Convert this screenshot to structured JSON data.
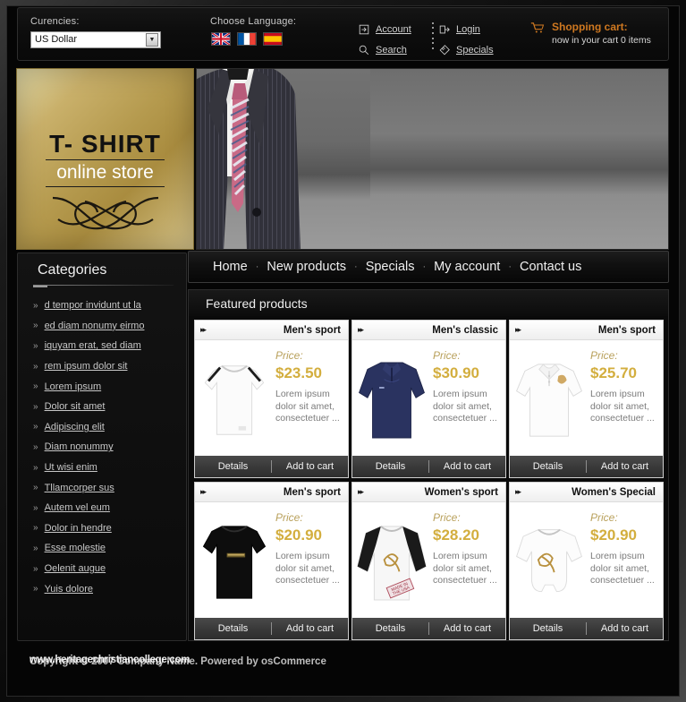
{
  "topbar": {
    "currency_label": "Curencies:",
    "currency_value": "US Dollar",
    "currency_options": [
      "US Dollar"
    ],
    "language_label": "Choose Language:",
    "flags": [
      {
        "name": "flag-english",
        "title": "English"
      },
      {
        "name": "flag-french",
        "title": "French"
      },
      {
        "name": "flag-spanish",
        "title": "Spanish"
      }
    ],
    "links": [
      {
        "label": "Account",
        "icon": "account-icon"
      },
      {
        "label": "Login",
        "icon": "login-icon"
      },
      {
        "label": "Search",
        "icon": "search-icon"
      },
      {
        "label": "Specials",
        "icon": "specials-icon"
      }
    ],
    "cart_title": "Shopping cart:",
    "cart_sub": "now in your cart 0 items",
    "cart_icon": "shopping-cart-icon"
  },
  "logo": {
    "title": "T- SHIRT",
    "subtitle": "online store"
  },
  "nav": {
    "items": [
      "Home",
      "New products",
      "Specials",
      "My account",
      "Contact us"
    ],
    "separator": "·"
  },
  "sidebar": {
    "title": "Categories",
    "bullet": "»",
    "items": [
      "d tempor invidunt ut la",
      "ed diam nonumy eirmo",
      "iquyam erat, sed diam",
      "rem ipsum dolor sit",
      "Lorem ipsum",
      "Dolor sit amet",
      "Adipiscing elit",
      "Diam nonummy",
      "Ut wisi enim",
      "Tllamcorper sus",
      "Autem vel eum",
      "Dolor in hendre",
      "Esse molestie",
      "Oelenit augue",
      "Yuis dolore"
    ]
  },
  "featured": {
    "heading": "Featured products",
    "price_label": "Price:",
    "details_label": "Details",
    "add_to_cart_label": "Add to cart",
    "card_arrow": "▸▸",
    "products": [
      {
        "title": "Men's sport",
        "price": "$23.50",
        "desc": "Lorem ipsum dolor sit amet, consectetuer ...",
        "image": "white-tshirt"
      },
      {
        "title": "Men's classic",
        "price": "$30.90",
        "desc": "Lorem ipsum dolor sit amet, consectetuer ...",
        "image": "navy-pullover"
      },
      {
        "title": "Men's sport",
        "price": "$25.70",
        "desc": "Lorem ipsum dolor sit amet, consectetuer ...",
        "image": "white-polo"
      },
      {
        "title": "Men's sport",
        "price": "$20.90",
        "desc": "Lorem ipsum dolor sit amet, consectetuer ...",
        "image": "black-tshirt"
      },
      {
        "title": "Women's sport",
        "price": "$28.20",
        "desc": "Lorem ipsum dolor sit amet, consectetuer ...",
        "image": "raglan-tee"
      },
      {
        "title": "Women's Special",
        "price": "$20.90",
        "desc": "Lorem ipsum dolor sit amet, consectetuer ...",
        "image": "white-onesie"
      }
    ]
  },
  "footer": {
    "copyright": "Copyright © 2007 Company Name. Powered by osCommerce",
    "watermark": "www.heritagechristiancollege.com"
  },
  "colors": {
    "gold": "#d3ae3e",
    "orange": "#cf7820",
    "panel": "#0a0a0a"
  }
}
